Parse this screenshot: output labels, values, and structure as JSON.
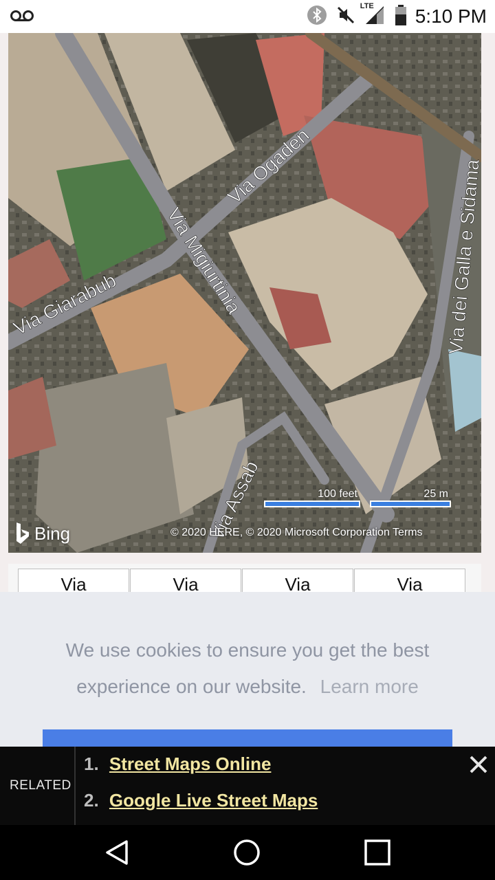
{
  "status_bar": {
    "time": "5:10 PM",
    "network": "LTE",
    "icons": [
      "voicemail-icon",
      "bluetooth-icon",
      "mute-icon",
      "signal-icon",
      "battery-icon"
    ]
  },
  "map": {
    "streets": [
      "Via Ogaden",
      "Via Migiurtinia",
      "Via Giarabub",
      "Via dei Galla e Sidama",
      "Via Assab"
    ],
    "bing_label": "Bing",
    "attribution": "© 2020 HERE, © 2020 Microsoft Corporation  Terms",
    "scale_feet": "100 feet",
    "scale_m": "25 m"
  },
  "tabs": [
    "Via",
    "Via",
    "Via",
    "Via"
  ],
  "cookie": {
    "text": "We use cookies to ensure you get the best experience on our website.",
    "learn_more": "Learn more"
  },
  "related": {
    "label": "RELATED",
    "items": [
      {
        "num": "1.",
        "text": "Street Maps Online"
      },
      {
        "num": "2.",
        "text": "Google Live Street Maps"
      }
    ]
  },
  "colors": {
    "accent": "#4a7ee6",
    "link": "#f2e6a2"
  }
}
